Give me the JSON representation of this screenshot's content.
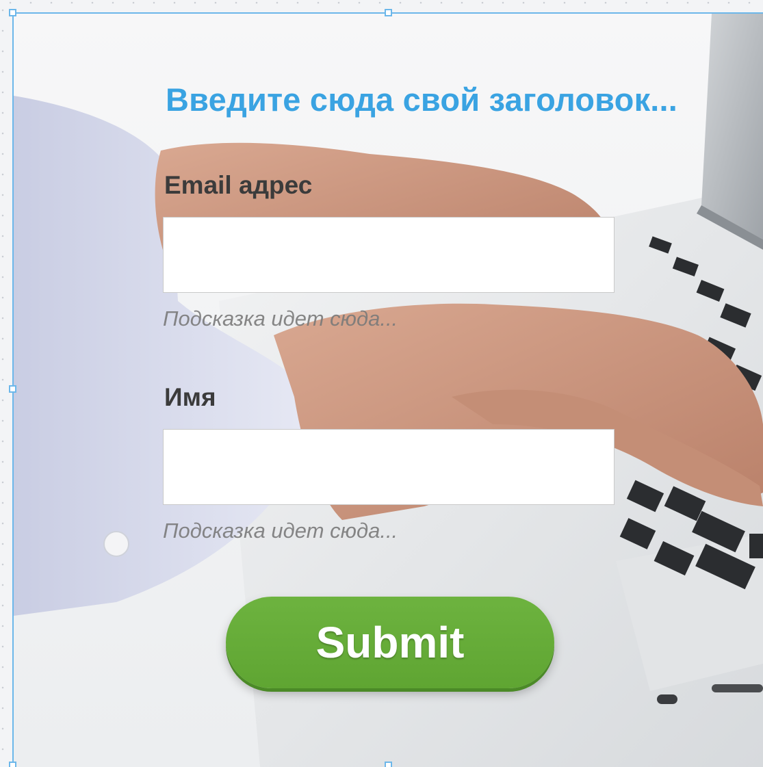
{
  "form": {
    "title": "Введите сюда свой заголовок...",
    "email": {
      "label": "Email адрес",
      "value": "",
      "hint": "Подсказка идет сюда..."
    },
    "name": {
      "label": "Имя",
      "value": "",
      "hint": "Подсказка идет сюда..."
    },
    "submit_label": "Submit"
  },
  "background": {
    "icon": "hands-typing-on-laptop-photo"
  },
  "colors": {
    "title": "#3aa3e2",
    "submit": "#62aa35",
    "selection_frame": "#6cb7ea",
    "label": "#3b3b3b",
    "hint": "#7a7a7a"
  }
}
